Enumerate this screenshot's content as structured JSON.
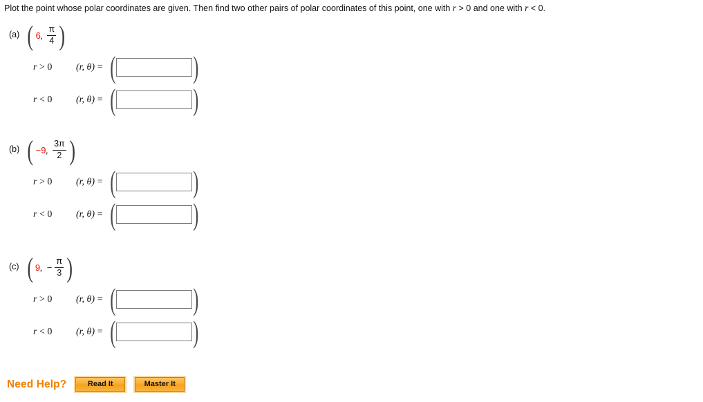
{
  "prompt": {
    "text_1": "Plot the point whose polar coordinates are given. Then find two other pairs of polar coordinates of this point, one with ",
    "var_r_1": "r",
    "text_2": " > 0 and one with ",
    "var_r_2": "r",
    "text_3": " < 0."
  },
  "parts": [
    {
      "label": "(a)",
      "given": {
        "r": "6",
        "r_sign": "",
        "theta_numerator": "π",
        "theta_denominator": "4",
        "theta_sign": ""
      },
      "rows": [
        {
          "condition_var": "r",
          "condition_op": " > 0",
          "expression": "(r, θ)",
          "equals": "=",
          "value": "",
          "placeholder": ""
        },
        {
          "condition_var": "r",
          "condition_op": " < 0",
          "expression": "(r, θ)",
          "equals": "=",
          "value": "",
          "placeholder": ""
        }
      ]
    },
    {
      "label": "(b)",
      "given": {
        "r": "−9",
        "r_sign": "",
        "theta_numerator": "3π",
        "theta_denominator": "2",
        "theta_sign": ""
      },
      "rows": [
        {
          "condition_var": "r",
          "condition_op": " > 0",
          "expression": "(r, θ)",
          "equals": "=",
          "value": "",
          "placeholder": ""
        },
        {
          "condition_var": "r",
          "condition_op": " < 0",
          "expression": "(r, θ)",
          "equals": "=",
          "value": "",
          "placeholder": ""
        }
      ]
    },
    {
      "label": "(c)",
      "given": {
        "r": "9",
        "r_sign": "",
        "theta_numerator": "π",
        "theta_denominator": "3",
        "theta_sign": "−"
      },
      "rows": [
        {
          "condition_var": "r",
          "condition_op": " > 0",
          "expression": "(r, θ)",
          "equals": "=",
          "value": "",
          "placeholder": ""
        },
        {
          "condition_var": "r",
          "condition_op": " < 0",
          "expression": "(r, θ)",
          "equals": "=",
          "value": "",
          "placeholder": ""
        }
      ]
    }
  ],
  "need_help": {
    "label": "Need Help?",
    "buttons": [
      {
        "label": "Read It"
      },
      {
        "label": "Master It"
      }
    ]
  },
  "colors": {
    "given_value": "#e8140c",
    "need_help_text": "#f08000",
    "button_border": "#d07800",
    "input_border": "#7b7b7b",
    "body_text": "#111111"
  },
  "symbols": {
    "comma": ",",
    "open_paren": "(",
    "close_paren": ")"
  }
}
